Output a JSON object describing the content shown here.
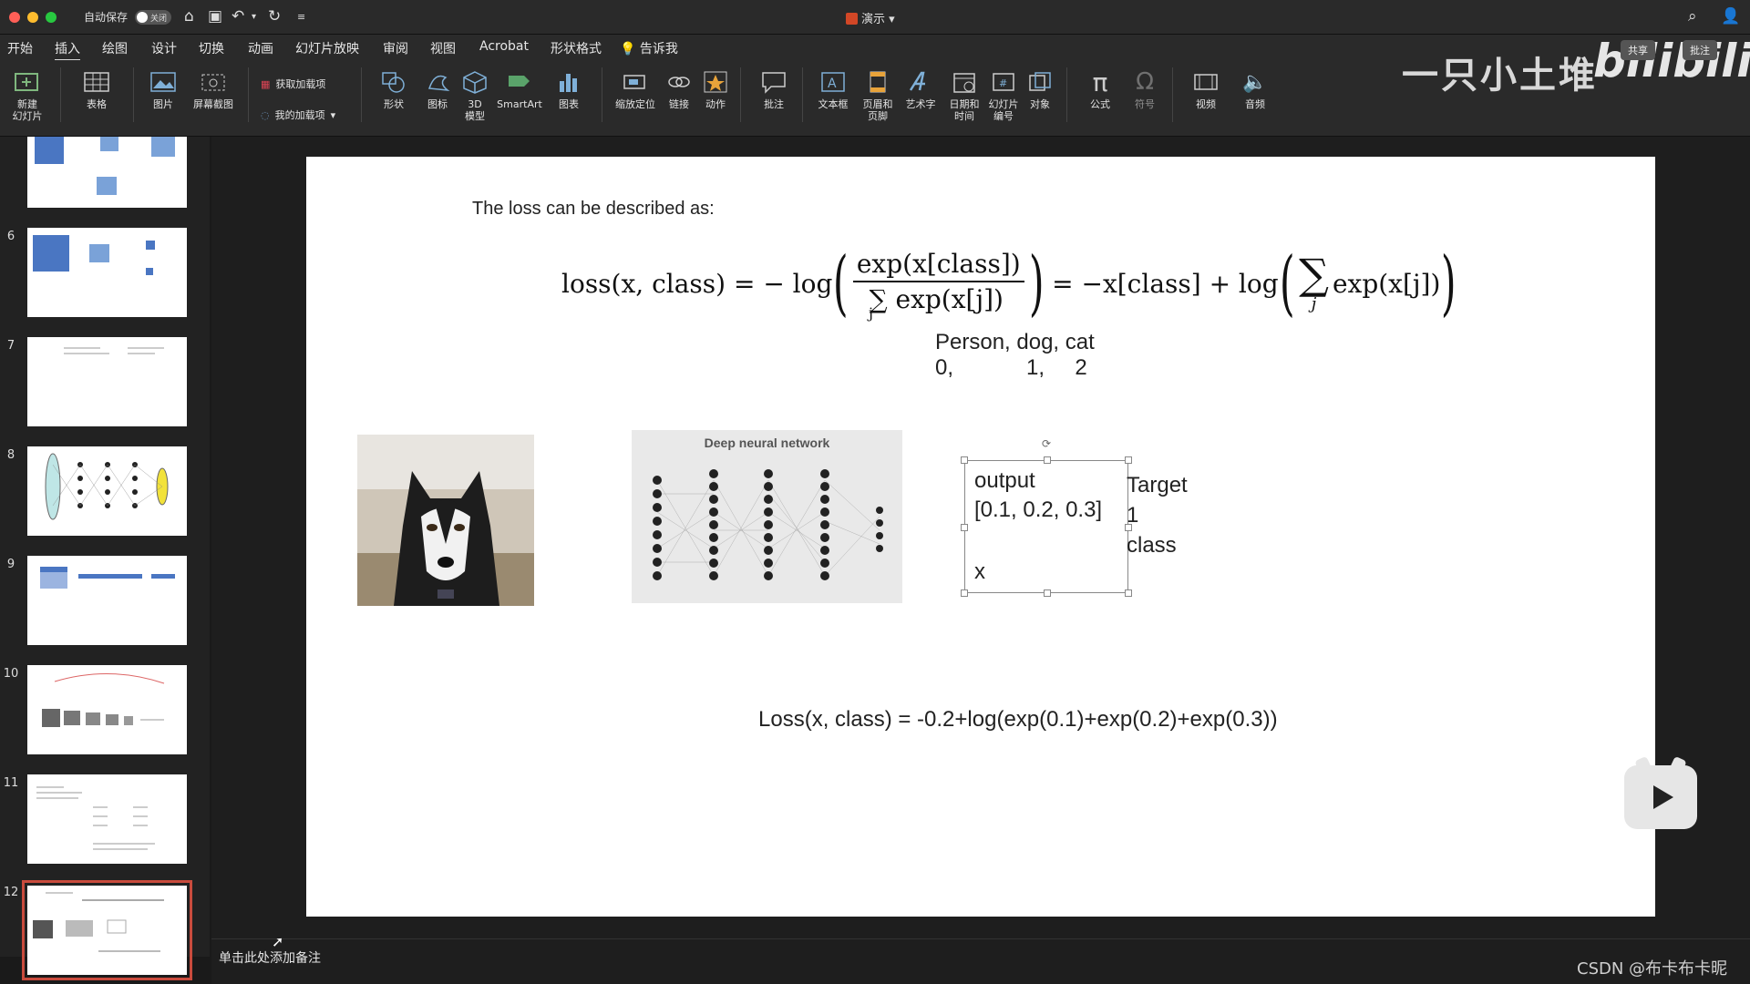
{
  "titlebar": {
    "autosave_label": "自动保存",
    "autosave_state": "关闭",
    "document_title": "演示"
  },
  "menu": {
    "items": [
      "开始",
      "插入",
      "绘图",
      "设计",
      "切换",
      "动画",
      "幻灯片放映",
      "审阅",
      "视图",
      "Acrobat",
      "形状格式"
    ],
    "tell_me": "告诉我",
    "active": "插入"
  },
  "ribbon": {
    "new_slide": "新建\n幻灯片",
    "table": "表格",
    "picture": "图片",
    "screenshot": "屏幕截图",
    "get_addins": "获取加载项",
    "my_addins": "我的加载项",
    "shapes": "形状",
    "icons": "图标",
    "model3d": "3D\n模型",
    "smartart": "SmartArt",
    "chart": "图表",
    "zoom": "缩放定位",
    "link": "链接",
    "action": "动作",
    "comment": "批注",
    "textbox": "文本框",
    "header_footer": "页眉和\n页脚",
    "wordart": "艺术字",
    "date_time": "日期和\n时间",
    "slide_number": "幻灯片\n编号",
    "object": "对象",
    "equation": "公式",
    "symbol": "符号",
    "video": "视频",
    "audio": "音频"
  },
  "overlay": {
    "channel_name": "一只小土堆",
    "platform_logo": "bilibili",
    "share_label": "共享",
    "comments_label": "批注",
    "csdn_watermark": "CSDN @布卡布卡昵"
  },
  "thumbnails": [
    {
      "num": ""
    },
    {
      "num": "6"
    },
    {
      "num": "7"
    },
    {
      "num": "8"
    },
    {
      "num": "9"
    },
    {
      "num": "10"
    },
    {
      "num": "11"
    },
    {
      "num": "12",
      "selected": true
    }
  ],
  "slide": {
    "intro": "The loss can be described as:",
    "formula": {
      "lhs": "loss(x, class) = − log",
      "num": "exp(x[class])",
      "den": "∑ exp(x[j])",
      "den_sub": "j",
      "mid": "= −x[class] + log",
      "sum_body": "exp(x[j])",
      "sum_sub": "j"
    },
    "classes_line1": "Person, dog, cat",
    "classes_line2": "0,            1,     2",
    "dnn_title": "Deep neural network",
    "output_box": {
      "line1": "output",
      "line2": "[0.1, 0.2, 0.3]",
      "line3": "x"
    },
    "target": {
      "line1": "Target",
      "line2": "1",
      "line3": "class"
    },
    "loss_example": "Loss(x, class) = -0.2+log(exp(0.1)+exp(0.2)+exp(0.3))"
  },
  "notes_placeholder": "单击此处添加备注"
}
